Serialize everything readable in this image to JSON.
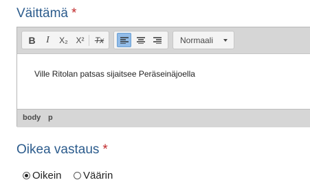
{
  "statement": {
    "label": "Väittämä",
    "required_mark": "*"
  },
  "editor": {
    "toolbar": {
      "bold": "B",
      "italic": "I",
      "subscript": "X₂",
      "superscript": "X²",
      "remove_format": "Tx",
      "format_select": "Normaali"
    },
    "content": "Ville Ritolan patsas sijaitsee Peräseinäjoella",
    "path": [
      "body",
      "p"
    ]
  },
  "answer": {
    "label": "Oikea vastaus",
    "required_mark": "*",
    "options": [
      {
        "label": "Oikein",
        "checked": true
      },
      {
        "label": "Väärin",
        "checked": false
      }
    ]
  }
}
